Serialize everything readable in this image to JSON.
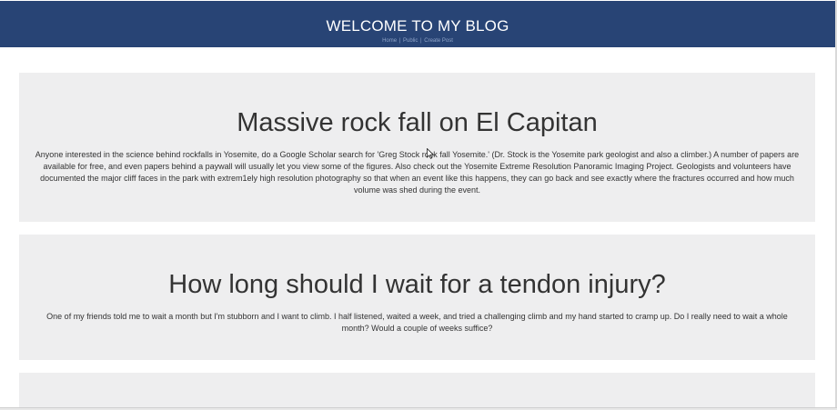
{
  "header": {
    "title": "WELCOME TO MY BLOG",
    "nav": [
      {
        "label": "Home"
      },
      {
        "label": "Public"
      },
      {
        "label": "Create Post"
      }
    ],
    "separator": "|",
    "background_color": "#284475"
  },
  "posts": [
    {
      "title": "Massive rock fall on El Capitan",
      "body": "Anyone interested in the science behind rockfalls in Yosemite, do a Google Scholar search for 'Greg Stock rock fall Yosemite.' (Dr. Stock is the Yosemite park geologist and also a climber.) A number of papers are available for free, and even papers behind a paywall will usually let you view some of the figures. Also check out the Yosemite Extreme Resolution Panoramic Imaging Project. Geologists and volunteers have documented the major cliff faces in the park with extrem1ely high resolution photography so that when an event like this happens, they can go back and see exactly where the fractures occurred and how much volume was shed during the event."
    },
    {
      "title": "How long should I wait for a tendon injury?",
      "body": "One of my friends told me to wait a month but I'm stubborn and I want to climb. I half listened, waited a week, and tried a challenging climb and my hand started to cramp up. Do I really need to wait a whole month? Would a couple of weeks suffice?"
    },
    {
      "title": "",
      "body": ""
    }
  ],
  "colors": {
    "card_background": "#eeeeef",
    "text": "#333333"
  },
  "cursor_icon": "arrow-pointer-icon"
}
